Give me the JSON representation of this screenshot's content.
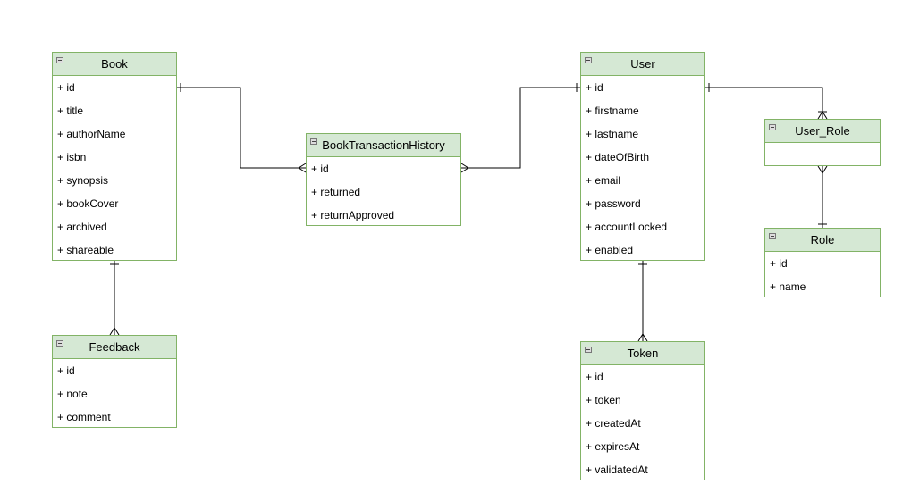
{
  "entities": {
    "book": {
      "title": "Book",
      "fields": [
        "+ id",
        "+ title",
        "+ authorName",
        "+ isbn",
        "+ synopsis",
        "+ bookCover",
        "+ archived",
        "+ shareable"
      ]
    },
    "bth": {
      "title": "BookTransactionHistory",
      "fields": [
        "+ id",
        "+ returned",
        "+ returnApproved"
      ]
    },
    "user": {
      "title": "User",
      "fields": [
        "+ id",
        "+ firstname",
        "+ lastname",
        "+ dateOfBirth",
        "+ email",
        "+ password",
        "+ accountLocked",
        "+ enabled"
      ]
    },
    "user_role": {
      "title": "User_Role",
      "fields": []
    },
    "role": {
      "title": "Role",
      "fields": [
        "+ id",
        "+ name"
      ]
    },
    "feedback": {
      "title": "Feedback",
      "fields": [
        "+ id",
        "+ note",
        "+ comment"
      ]
    },
    "token": {
      "title": "Token",
      "fields": [
        "+ id",
        "+ token",
        "+ createdAt",
        "+ expiresAt",
        "+ validatedAt"
      ]
    }
  },
  "relationships": [
    {
      "from": "Book",
      "to": "BookTransactionHistory",
      "from_card": "one",
      "to_card": "many"
    },
    {
      "from": "User",
      "to": "BookTransactionHistory",
      "from_card": "one",
      "to_card": "many"
    },
    {
      "from": "User",
      "to": "User_Role",
      "from_card": "one",
      "to_card": "one-or-many"
    },
    {
      "from": "Role",
      "to": "User_Role",
      "from_card": "one",
      "to_card": "many"
    },
    {
      "from": "Book",
      "to": "Feedback",
      "from_card": "one",
      "to_card": "many"
    },
    {
      "from": "User",
      "to": "Token",
      "from_card": "one",
      "to_card": "many"
    }
  ],
  "colors": {
    "header_fill": "#d5e8d4",
    "border": "#82b366"
  }
}
